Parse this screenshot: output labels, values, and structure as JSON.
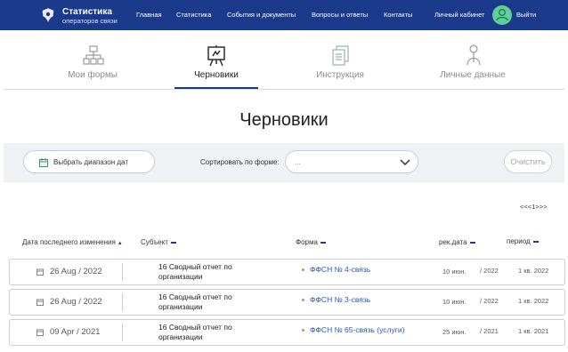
{
  "header": {
    "brand_title": "Статистика",
    "brand_subtitle": "операторов связи",
    "nav": [
      "Главная",
      "Статистика",
      "События и документы",
      "Вопросы и ответы",
      "Контакты"
    ],
    "cabinet": "Личный кабинет",
    "logout": "Выйти",
    "colors": {
      "bar": "#1b3a8c",
      "avatar": "#5fcf9a"
    }
  },
  "tabs": [
    {
      "label": "Мои формы",
      "icon": "org-chart-icon",
      "active": false
    },
    {
      "label": "Черновики",
      "icon": "easel-icon",
      "active": true
    },
    {
      "label": "Инструкция",
      "icon": "documents-icon",
      "active": false
    },
    {
      "label": "Личные данные",
      "icon": "person-icon",
      "active": false
    }
  ],
  "page_title": "Черновики",
  "filters": {
    "date_range_label": "Выбрать диапазон дат",
    "sort_label": "Сортировать по форме:",
    "sort_placeholder": "...",
    "clear_label": "Очистить"
  },
  "pagination": "<<<1>>>",
  "columns": {
    "date": "Дата последнего изменения",
    "subject": "Субъект",
    "form": "Форма",
    "report_date": "рек.дата",
    "period": "период"
  },
  "rows": [
    {
      "date": "26 Aug / 2022",
      "subject": "16 Сводный отчет по организации",
      "form": "ФФСН № 4-связь",
      "report_day": "10 июн.",
      "report_year": "/ 2022",
      "period": "1 кв. 2022"
    },
    {
      "date": "26 Aug / 2022",
      "subject": "16 Сводный отчет по организации",
      "form": "ФФСН № 3-связь",
      "report_day": "10 июн.",
      "report_year": "/ 2022",
      "period": "1 кв. 2022"
    },
    {
      "date": "09 Apr / 2021",
      "subject": "16 Сводный отчет по организации",
      "form": "ФФСН № 65-связь (услуги)",
      "report_day": "25 июн.",
      "report_year": "/ 2021",
      "period": "1 кв. 2021"
    }
  ]
}
